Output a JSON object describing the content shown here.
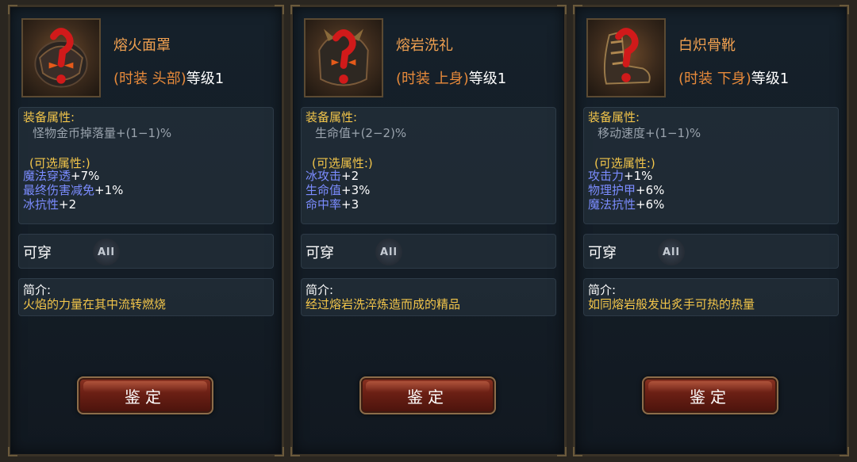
{
  "cards": [
    {
      "name": "熔火面罩",
      "type_prefix": "(时装 ",
      "type_slot": "头部",
      "type_suffix": ")",
      "level_text": "等级1",
      "attr_title": "装备属性:",
      "base_attr": "怪物金币掉落量+(1−1)%",
      "opt_title": "(可选属性:)",
      "opts": [
        {
          "name": "魔法穿透",
          "value": "+7%"
        },
        {
          "name": "最终伤害减免",
          "value": "+1%"
        },
        {
          "name": "冰抗性",
          "value": "+2"
        }
      ],
      "wear_label": "可穿",
      "wear_badge": "All",
      "intro_title": "简介:",
      "intro_text": "火焰的力量在其中流转燃烧",
      "button_label": "鉴定",
      "icon": "lava-mask-icon"
    },
    {
      "name": "熔岩洗礼",
      "type_prefix": "(时装 ",
      "type_slot": "上身",
      "type_suffix": ")",
      "level_text": "等级1",
      "attr_title": "装备属性:",
      "base_attr": "生命值+(2−2)%",
      "opt_title": "(可选属性:)",
      "opts": [
        {
          "name": "冰攻击",
          "value": "+2"
        },
        {
          "name": "生命值",
          "value": "+3%"
        },
        {
          "name": "命中率",
          "value": "+3"
        }
      ],
      "wear_label": "可穿",
      "wear_badge": "All",
      "intro_title": "简介:",
      "intro_text": "经过熔岩洗淬炼造而成的精品",
      "button_label": "鉴定",
      "icon": "lava-armor-icon"
    },
    {
      "name": "白炽骨靴",
      "type_prefix": "(时装 ",
      "type_slot": "下身",
      "type_suffix": ")",
      "level_text": "等级1",
      "attr_title": "装备属性:",
      "base_attr": "移动速度+(1−1)%",
      "opt_title": "(可选属性:)",
      "opts": [
        {
          "name": "攻击力",
          "value": "+1%"
        },
        {
          "name": "物理护甲",
          "value": "+6%"
        },
        {
          "name": "魔法抗性",
          "value": "+6%"
        }
      ],
      "wear_label": "可穿",
      "wear_badge": "All",
      "intro_title": "简介:",
      "intro_text": "如同熔岩般发出炙手可热的热量",
      "button_label": "鉴定",
      "icon": "bone-boots-icon"
    }
  ],
  "colors": {
    "name": "#f0a050",
    "gold": "#f2c54a",
    "opt_name": "#7b8cff",
    "question_mark": "#d11a1a"
  }
}
